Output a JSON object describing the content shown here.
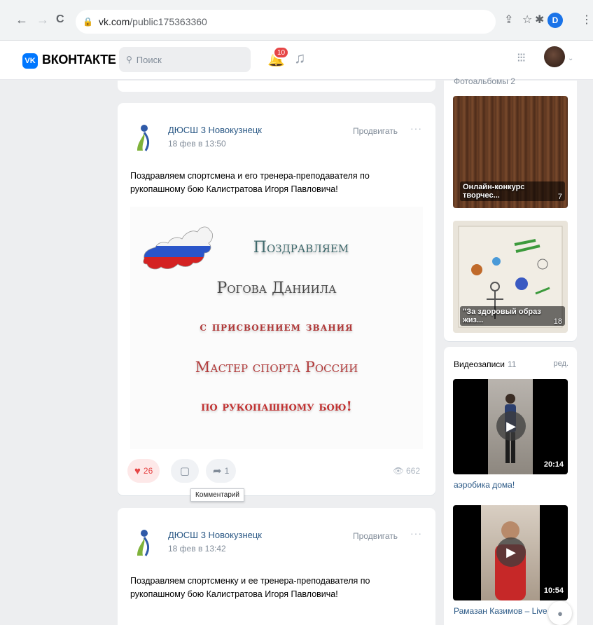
{
  "browser": {
    "back": "←",
    "forward": "→",
    "reload": "C",
    "url_host": "vk.com",
    "url_path": "/public175363360",
    "profile_initial": "D"
  },
  "header": {
    "brand": "ВКОНТАКТЕ",
    "logo_text": "VK",
    "search_placeholder": "Поиск",
    "notifications_count": "10"
  },
  "posts": [
    {
      "author": "ДЮСШ 3 Новокузнецк",
      "date": "18 фев в 13:50",
      "promote": "Продвигать",
      "more": "···",
      "text": "Поздравляем спортсмена и его тренера-преподавателя по рукопашному бою Калистратова Игоря Павловича!",
      "image_lines": [
        "Поздравляем",
        "Рогова Даниила",
        "с присвоением звания",
        "Мастер спорта России",
        "по рукопашному бою!"
      ],
      "likes": "26",
      "shares": "1",
      "views": "662"
    },
    {
      "author": "ДЮСШ 3 Новокузнецк",
      "date": "18 фев в 13:42",
      "promote": "Продвигать",
      "more": "···",
      "text": "Поздравляем спортсменку и ее тренера-преподавателя по рукопашному бою Калистратова Игоря Павловича!"
    }
  ],
  "tooltip": "Комментарий",
  "sidebar": {
    "albums_header_cut": "Фотоальбомы 2",
    "albums": [
      {
        "title": "Онлайн-конкурс творчес...",
        "count": "7"
      },
      {
        "title": "\"За здоровый образ жиз...",
        "count": "18"
      }
    ],
    "videos_header": "Видеозаписи",
    "videos_count": "11",
    "videos_edit": "ред.",
    "videos": [
      {
        "duration": "20:14",
        "title": "аэробика дома!"
      },
      {
        "duration": "10:54",
        "title": "Рамазан Казимов – Live"
      }
    ]
  }
}
